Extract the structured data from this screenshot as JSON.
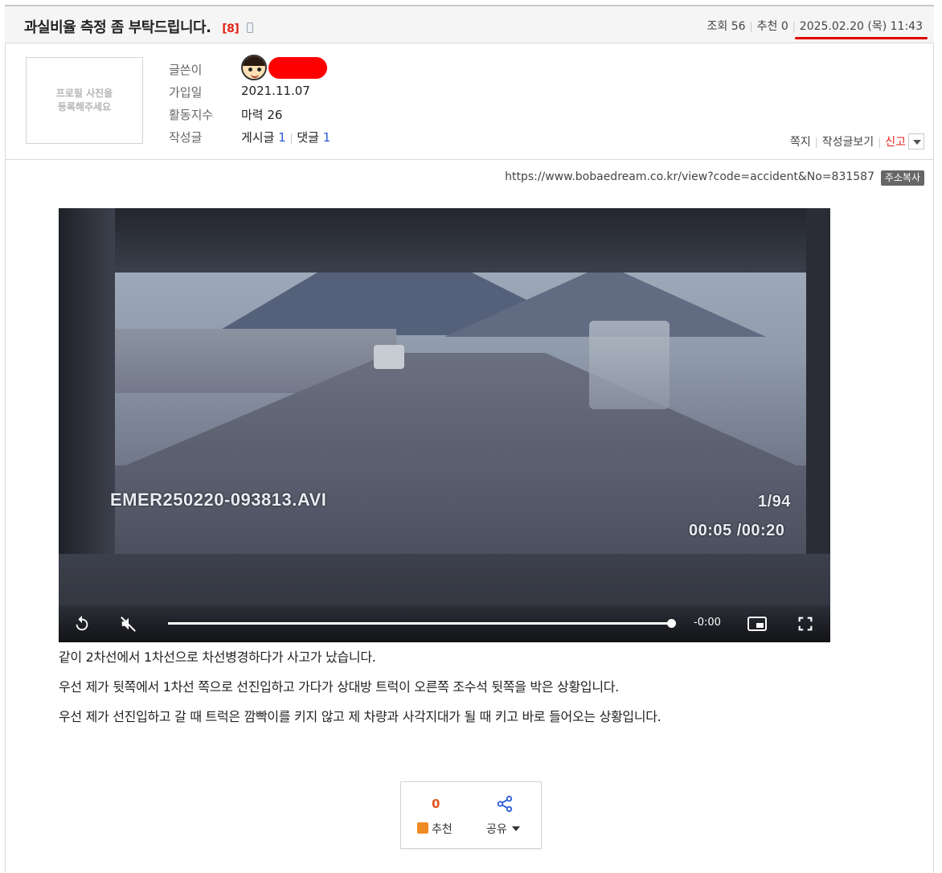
{
  "post": {
    "title": "과실비율 측정 좀 부탁드립니다.",
    "comment_count": "[8]",
    "views_label": "조회 56",
    "recommend_label": "추천 0",
    "datetime": "2025.02.20 (목) 11:43"
  },
  "profile": {
    "photo_placeholder": "프로필 사진을\n등록해주세요",
    "labels": {
      "author": "글쓴이",
      "joined": "가입일",
      "activity": "활동지수",
      "written": "작성글"
    },
    "joined": "2021.11.07",
    "activity": "마력 26",
    "posts_label": "게시글",
    "posts_count": "1",
    "comments_label": "댓글",
    "comments_count": "1"
  },
  "actions": {
    "message": "쪽지",
    "view_posts": "작성글보기",
    "report": "신고"
  },
  "url": {
    "text": "https://www.bobaedream.co.kr/view?code=accident&No=831587",
    "copy_button": "주소복사"
  },
  "video": {
    "filename": "EMER250220-093813.AVI",
    "frame": "1/94",
    "timecode": "00:05 /00:20",
    "remaining": "-0:00",
    "progress": 1.0
  },
  "body": [
    "같이 2차선에서 1차선으로 차선병경하다가 사고가 났습니다.",
    "우선 제가 뒷쪽에서 1차선 쪽으로 선진입하고 가다가 상대방 트럭이 오른쪽 조수석 뒷쪽을 박은 상황입니다.",
    "우선 제가 선진입하고 갈 때 트럭은 깜빡이를 키지 않고 제 차량과 사각지대가 될 때 키고 바로 들어오는 상황입니다."
  ],
  "recommend_box": {
    "count": "0",
    "recommend": "추천",
    "share": "공유"
  },
  "colors": {
    "accent_red": "#e2231a",
    "link_blue": "#2a5bd7",
    "highlight_red": "#ff0000"
  }
}
